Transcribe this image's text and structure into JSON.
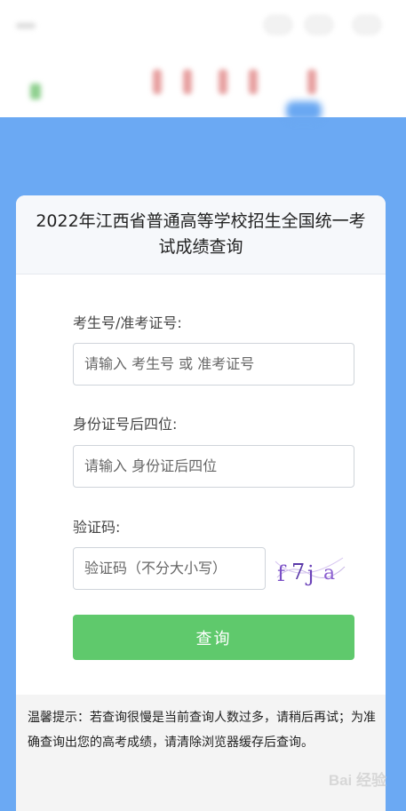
{
  "status_bar": {
    "signal_icon": "signal-icon",
    "battery_icon": "battery-icon",
    "wifi_icon": "wifi-icon"
  },
  "card": {
    "title": "2022年江西省普通高等学校招生全国统一考试成绩查询"
  },
  "form": {
    "exam_number": {
      "label": "考生号/准考证号:",
      "placeholder": "请输入 考生号 或 准考证号",
      "value": ""
    },
    "id_last_four": {
      "label": "身份证号后四位:",
      "placeholder": "请输入 身份证后四位",
      "value": ""
    },
    "captcha": {
      "label": "验证码:",
      "placeholder": "验证码（不分大小写）",
      "value": "",
      "image_text": "f7ja"
    },
    "submit_label": "查询"
  },
  "tips": {
    "text": "温馨提示：若查询很慢是当前查询人数过多，请稍后再试；为准确查询出您的高考成绩，请清除浏览器缓存后查询。"
  },
  "watermark": {
    "text": "Bai 经验"
  },
  "colors": {
    "background_blue": "#6ba9f3",
    "button_green": "#5fc96c",
    "tips_bg": "#f4f4f4"
  }
}
